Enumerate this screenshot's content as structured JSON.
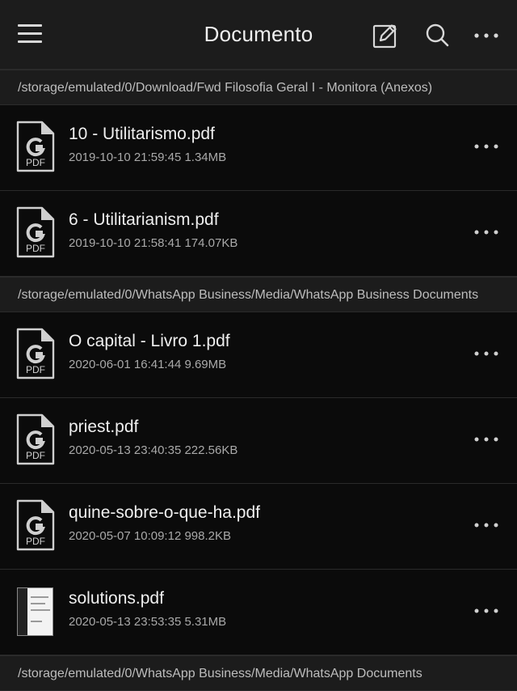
{
  "header": {
    "title": "Documento",
    "icons": [
      "menu-icon",
      "edit-icon",
      "search-icon",
      "more-icon"
    ]
  },
  "groups": [
    {
      "path": "/storage/emulated/0/Download/Fwd Filosofia Geral I - Monitora (Anexos)",
      "files": [
        {
          "name": "10 - Utilitarismo.pdf",
          "meta": "2019-10-10 21:59:45 1.34MB",
          "icon": "pdf-icon"
        },
        {
          "name": "6 - Utilitarianism.pdf",
          "meta": "2019-10-10 21:58:41 174.07KB",
          "icon": "pdf-icon"
        }
      ]
    },
    {
      "path": "/storage/emulated/0/WhatsApp Business/Media/WhatsApp Business Documents",
      "files": [
        {
          "name": "O capital - Livro 1.pdf",
          "meta": "2020-06-01 16:41:44 9.69MB",
          "icon": "pdf-icon"
        },
        {
          "name": "priest.pdf",
          "meta": "2020-05-13 23:40:35 222.56KB",
          "icon": "pdf-icon"
        },
        {
          "name": "quine-sobre-o-que-ha.pdf",
          "meta": "2020-05-07 10:09:12 998.2KB",
          "icon": "pdf-icon"
        },
        {
          "name": "solutions.pdf",
          "meta": "2020-05-13 23:53:35 5.31MB",
          "icon": "thumbnail-icon"
        }
      ]
    },
    {
      "path": "/storage/emulated/0/WhatsApp Business/Media/WhatsApp Documents",
      "files": []
    }
  ],
  "pdf_icon_label": "PDF",
  "colors": {
    "background": "#0b0b0b",
    "header": "#1c1c1c",
    "text": "#efefef",
    "subtext": "#a9a9a9"
  }
}
